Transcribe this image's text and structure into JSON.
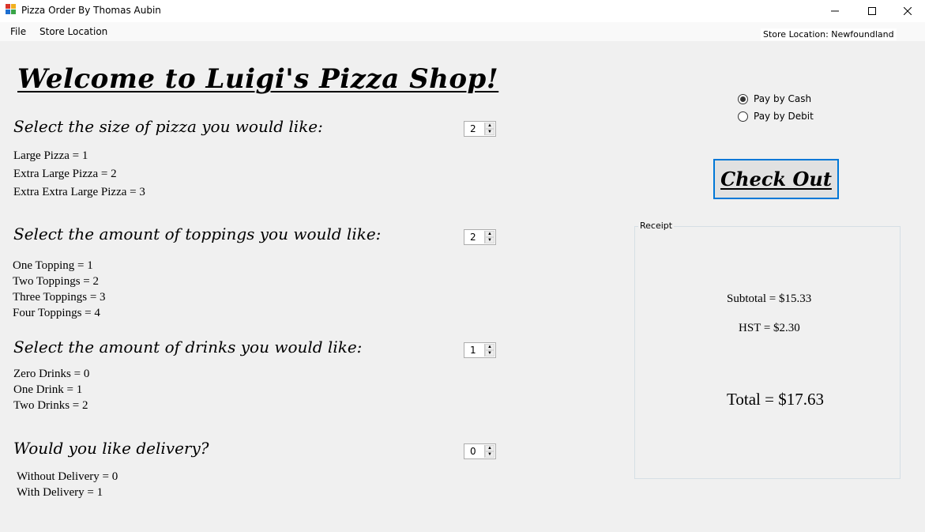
{
  "window": {
    "title": "Pizza Order By Thomas Aubin",
    "icon": "app-window-icon",
    "controls": [
      "minimize-icon",
      "maximize-icon",
      "close-icon"
    ]
  },
  "menu": {
    "file": "File",
    "store_location": "Store Location"
  },
  "status": {
    "store_location": "Store Location: Newfoundland"
  },
  "heading": "Welcome to Luigi's Pizza Shop!",
  "size": {
    "question": "Select the size of pizza you would like:",
    "value": "2",
    "options": [
      "Large Pizza = 1",
      "Extra Large Pizza = 2",
      "Extra Extra Large Pizza = 3"
    ]
  },
  "toppings": {
    "question": "Select the amount of toppings you would like:",
    "value": "2",
    "options": [
      "One Topping = 1",
      "Two Toppings = 2",
      "Three Toppings = 3",
      "Four Toppings = 4"
    ]
  },
  "drinks": {
    "question": "Select the amount of drinks you would like:",
    "value": "1",
    "options": [
      "Zero Drinks = 0",
      "One Drink = 1",
      "Two Drinks = 2"
    ]
  },
  "delivery": {
    "question": "Would you like delivery?",
    "value": "0",
    "options": [
      "Without Delivery = 0",
      "With Delivery = 1"
    ]
  },
  "payment": {
    "cash_label": "Pay by Cash",
    "debit_label": "Pay by Debit",
    "selected": "cash"
  },
  "checkout_label": "Check Out",
  "receipt": {
    "caption": "Receipt",
    "subtotal": "Subtotal = $15.33",
    "hst": "HST = $2.30",
    "total": "Total = $17.63"
  }
}
